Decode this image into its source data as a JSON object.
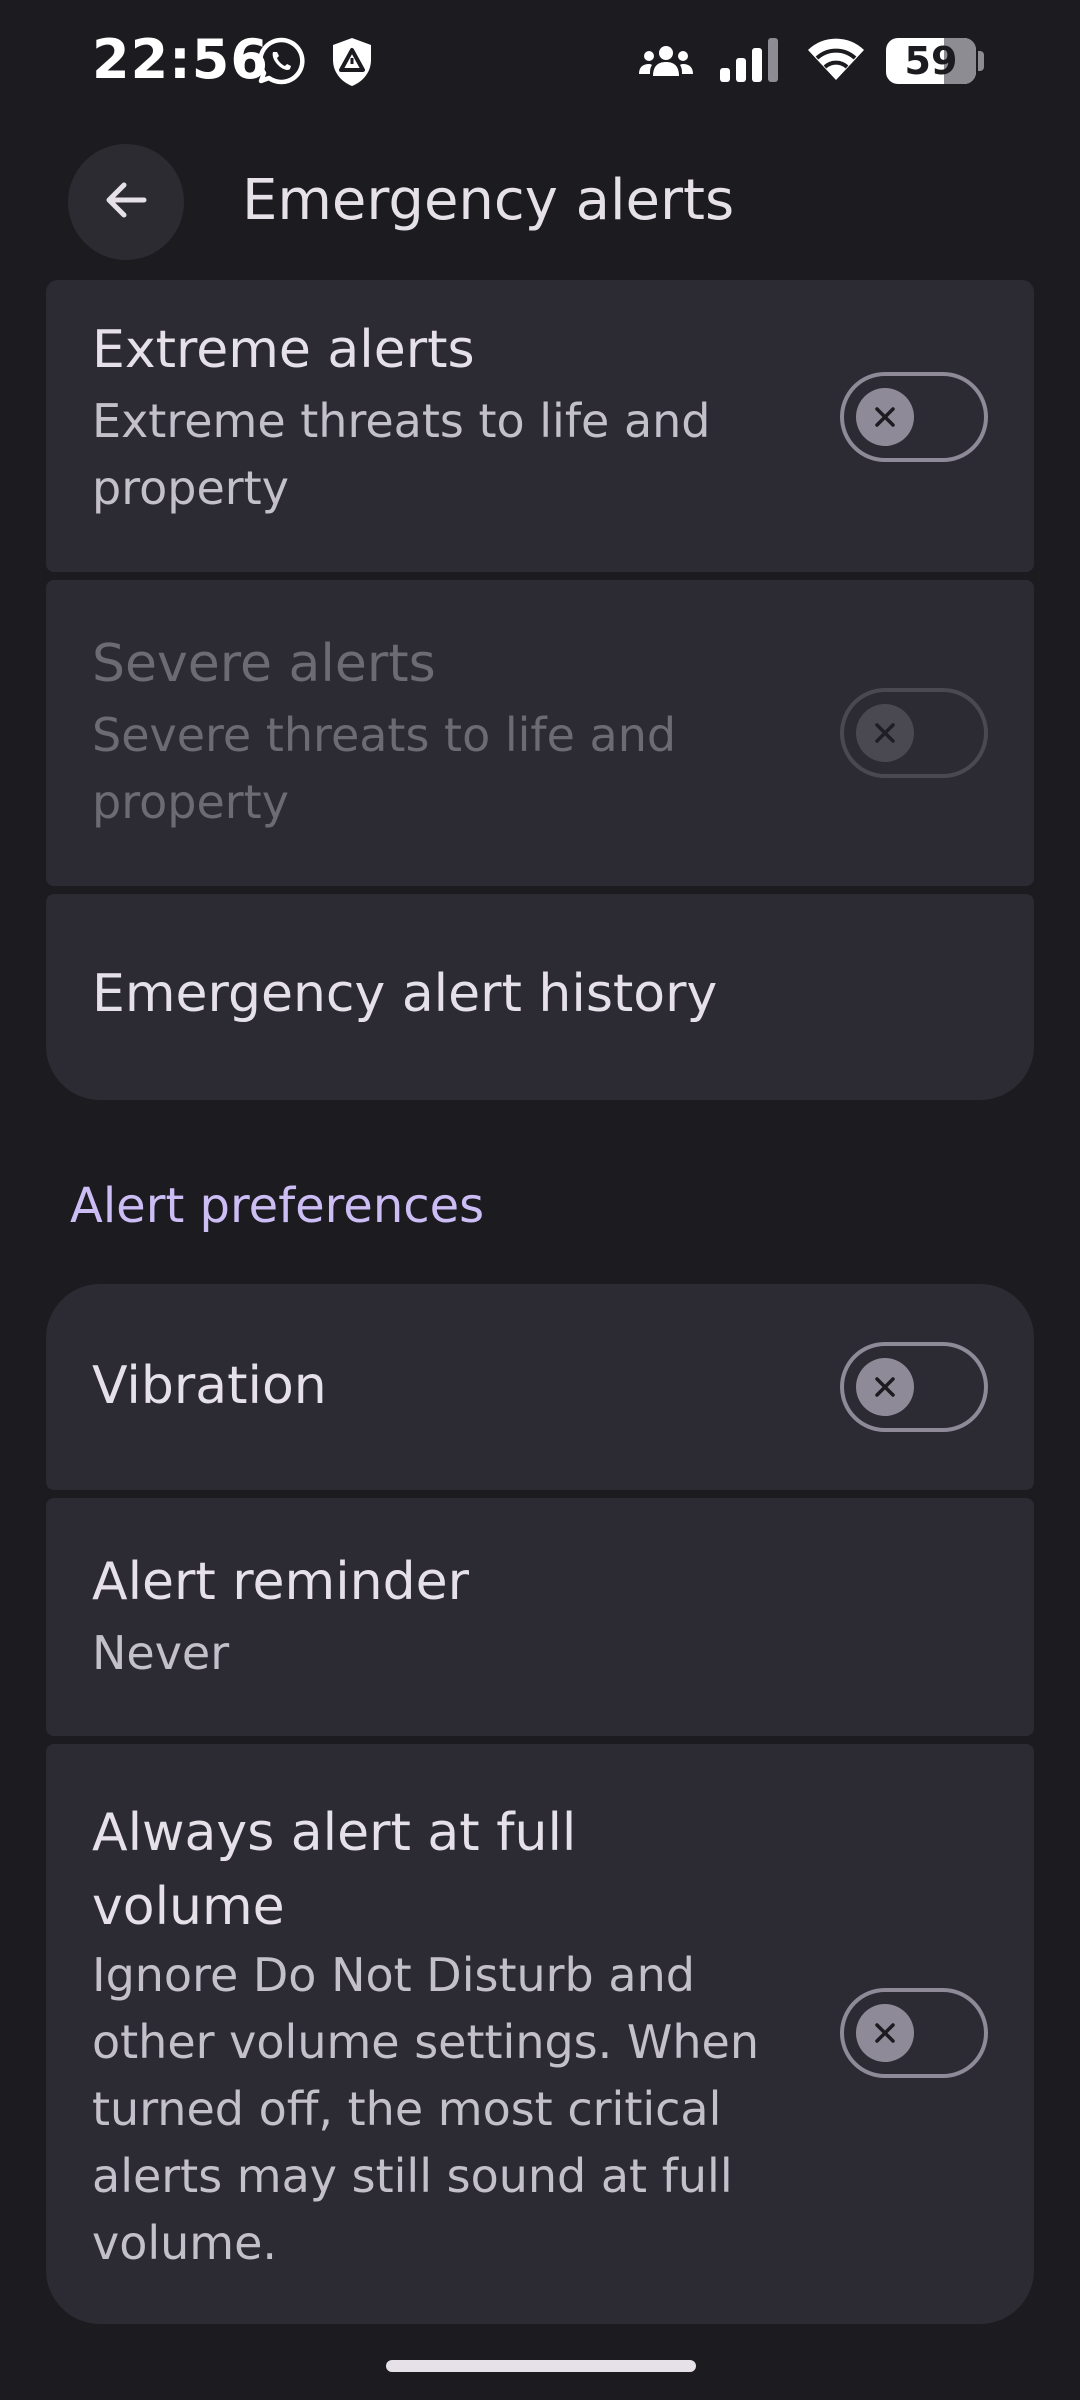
{
  "status_bar": {
    "time": "22:56",
    "battery_level": "59",
    "icons": [
      "whatsapp-icon",
      "shield-alert-icon",
      "people-icon",
      "signal-icon",
      "wifi-icon",
      "battery-icon"
    ]
  },
  "app_bar": {
    "title": "Emergency alerts",
    "back_icon": "arrow-back-icon"
  },
  "alerts": {
    "extreme": {
      "title": "Extreme alerts",
      "subtitle": "Extreme threats to life and property",
      "enabled": false
    },
    "severe": {
      "title": "Severe alerts",
      "subtitle": "Severe threats to life and property",
      "enabled": false,
      "disabled": true
    },
    "history": {
      "title": "Emergency alert history"
    }
  },
  "preferences": {
    "header": "Alert preferences",
    "vibration": {
      "title": "Vibration",
      "enabled": false
    },
    "reminder": {
      "title": "Alert reminder",
      "value": "Never"
    },
    "full_volume": {
      "title": "Always alert at full volume",
      "subtitle": "Ignore Do Not Disturb and other volume settings. When turned off, the most critical alerts may still sound at full volume.",
      "enabled": false
    }
  },
  "colors": {
    "background": "#1b1b20",
    "card": "#2c2b34",
    "accent": "#cdbdf5",
    "text": "#e6e1e9",
    "text_secondary": "#c4c0ca",
    "text_disabled": "#6c6a72"
  }
}
